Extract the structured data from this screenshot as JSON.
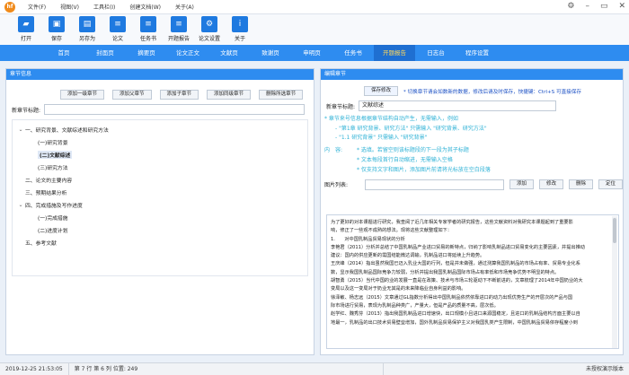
{
  "titlebar": {
    "logo_text": "hf",
    "menu": [
      "文件(F)",
      "视图(V)",
      "工具栏(I)",
      "创建文档(W)",
      "关于(A)"
    ]
  },
  "toolbar": [
    {
      "label": "打开",
      "icon": "folder-open-icon"
    },
    {
      "label": "保存",
      "icon": "save-icon"
    },
    {
      "label": "另存为",
      "icon": "save-as-icon"
    },
    {
      "label": "论文",
      "icon": "paper-icon"
    },
    {
      "label": "任务书",
      "icon": "task-book-icon"
    },
    {
      "label": "开题报告",
      "icon": "proposal-icon"
    },
    {
      "label": "论文设置",
      "icon": "paper-settings-icon"
    },
    {
      "label": "关于",
      "icon": "about-icon"
    }
  ],
  "nav": {
    "tabs": [
      "首页",
      "封面页",
      "摘要页",
      "论文正文",
      "文献页",
      "致谢页",
      "申明页",
      "任务书",
      "开题报告",
      "日志台",
      "程序设置"
    ],
    "active_index": 8
  },
  "left": {
    "header": "章节信息",
    "buttons": [
      "添加一级章节",
      "添加父章节",
      "添加子章节",
      "添加同级章节",
      "删除所选章节"
    ],
    "new_title_label": "新章节标题:",
    "new_title_value": "",
    "tree": [
      {
        "label": "一、研究背景、文献综述和研究方法",
        "level": 0,
        "caret": "⌄"
      },
      {
        "label": "(一)研究背景",
        "level": 1,
        "caret": ""
      },
      {
        "label": "(二)文献综述",
        "level": 1,
        "caret": "",
        "selected": true
      },
      {
        "label": "(三)研究方法",
        "level": 1,
        "caret": ""
      },
      {
        "label": "二、论文的主要内容",
        "level": 0,
        "caret": ""
      },
      {
        "label": "三、预期结果分析",
        "level": 0,
        "caret": ""
      },
      {
        "label": "四、完成措施及写作进度",
        "level": 0,
        "caret": "⌄"
      },
      {
        "label": "(一)完成措施",
        "level": 1,
        "caret": ""
      },
      {
        "label": "(二)进度计划",
        "level": 1,
        "caret": ""
      },
      {
        "label": "五、参考文献",
        "level": 0,
        "caret": ""
      }
    ]
  },
  "right": {
    "header": "编辑章节",
    "save_button": "保存修改",
    "save_tip": "* 切换章节请会如数新的数据，修改后请及时保存，快捷键：Ctrl+S 可直接保存",
    "new_title_label": "新章节标题:",
    "new_title_value": "文献综述",
    "hints": [
      "* 章节来号信息根据章节结构自动产生，无需输入，例如",
      "- \"第1章 研究背景、研究方法\" 只需输入 \"研究背景、研究方法\"",
      "- \"1.1 研究背景\" 只需输入 \"研究背景\""
    ],
    "content_label": "内　容:",
    "content_hints": [
      "* 选填。若留空则该标题段的下一段为其子标题",
      "* 文本每段首行自动缩进，无需输入空格",
      "* 仅支持文字和图片，添加图片前请将光标放在空白段落"
    ],
    "image_list_label": "图片列表:",
    "image_buttons": [
      "添加",
      "修改",
      "删除",
      "定位"
    ],
    "body_lines": [
      "为了更好的对本课题进行研究，我查阅了近几年相关专家学者的研究报告，这些文献资料对我研究本课题起到了重要影",
      "响，修正了一些观不成熟的想法。现将这些文献整理如下：",
      "1.　　对中国乳制品贸易现状的分析",
      "李艳君（2011）分析并总结了中国乳制品产业进口贸易的新特点，归纳了影响乳制品进口贸易变化的主要因素，并提出推动",
      "建议：国内的供应更新的需国结能微达调输，乳制品进口将延续上升趋势。",
      "王庆峰（2014）指出虽然我国已迈入乳业大国的行列，但是并未做强，通过测算我国乳制品的市场占有率、贸易专业化系",
      "数，显示我国乳制品国际竞争力较弱，分析并提出我国乳制品国际市场占有率低和市场竞争优势不明显的特点。",
      "胡智勇（2015）当代中国的业的发展一直是在政策、技术与市场三轮驱动下不断前进的，文章梳理了2014年中国奶业的大",
      "变局以及这一变局对于奶业无其是的未来降临业自身利益的影响。",
      "徐泽敏、杨志远（2015）文章通过GL指数分析得出中国乳制品依然依靠进口的动力出现优势生产的开层次的产品与国",
      "际市场进行贸易，表现为乳制品种类广，产量大，但是产品的质量不高，层次低。",
      "赵学红、魏秀芬（2013）指出我国乳制品进口增速快，出口规模小且进口来源国稳定，且进口的乳制品结构方面主要以自",
      "地最一，乳制品的出口技术贸易壁垒增加，国外乳制品贸易保护主义对我国乳类产生限制，中国乳制品贸易依存程度小到"
    ]
  },
  "status": [
    "2019-12-25 21:53:05",
    "第 7 行 第 6 列 位置: 249",
    "未授权演示版本"
  ]
}
